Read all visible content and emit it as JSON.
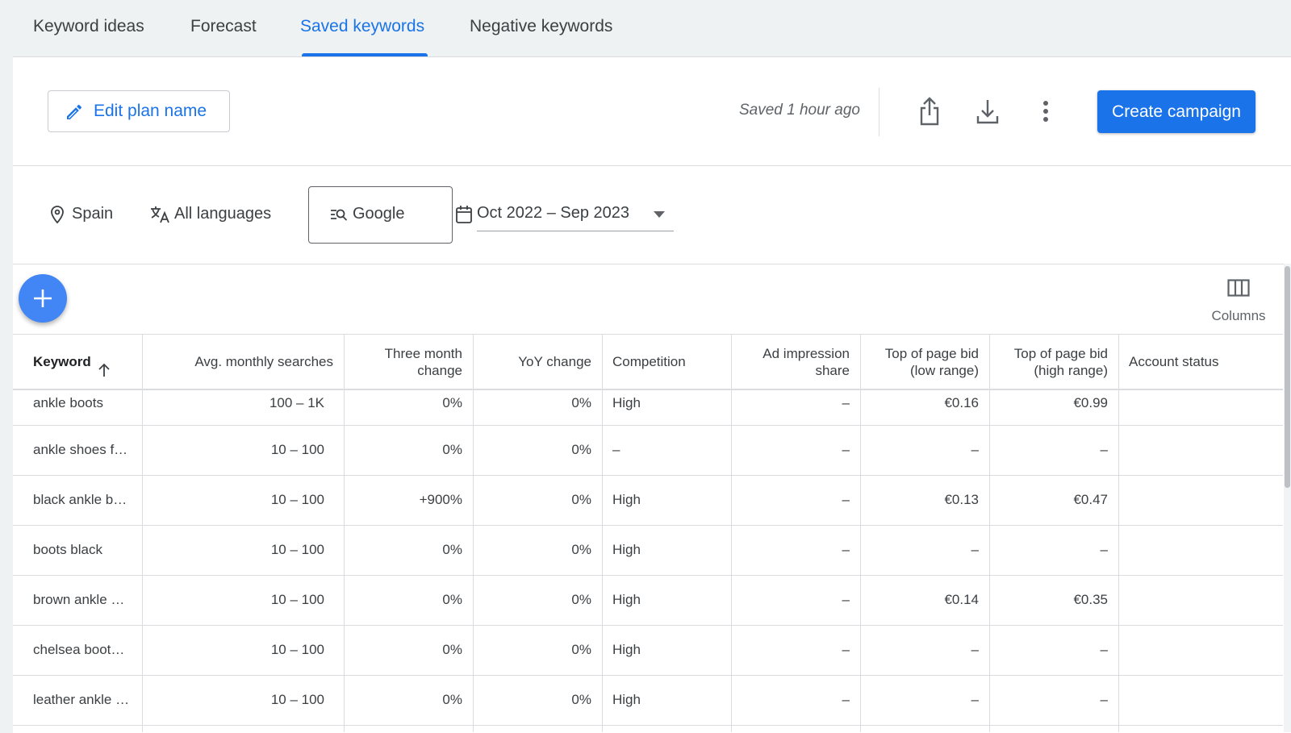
{
  "tabs": [
    {
      "label": "Keyword ideas",
      "active": false
    },
    {
      "label": "Forecast",
      "active": false
    },
    {
      "label": "Saved keywords",
      "active": true
    },
    {
      "label": "Negative keywords",
      "active": false
    }
  ],
  "header": {
    "edit_plan_label": "Edit plan name",
    "saved_status": "Saved 1 hour ago",
    "share_icon": "share-icon",
    "download_icon": "download-icon",
    "more_icon": "more-vert-icon",
    "create_campaign_label": "Create campaign"
  },
  "filters": {
    "location": "Spain",
    "language": "All languages",
    "network": "Google",
    "date_range": "Oct 2022 – Sep 2023"
  },
  "toolbar": {
    "add_icon": "plus-icon",
    "columns_label": "Columns"
  },
  "table": {
    "columns": [
      {
        "label": "Keyword",
        "align": "left",
        "sorted": "asc"
      },
      {
        "label": "Avg. monthly searches",
        "align": "right"
      },
      {
        "label": "Three month\nchange",
        "align": "right"
      },
      {
        "label": "YoY change",
        "align": "right"
      },
      {
        "label": "Competition",
        "align": "left"
      },
      {
        "label": "Ad impression\nshare",
        "align": "right"
      },
      {
        "label": "Top of page bid\n(low range)",
        "align": "right"
      },
      {
        "label": "Top of page bid\n(high range)",
        "align": "right"
      },
      {
        "label": "Account status",
        "align": "left"
      }
    ],
    "rows": [
      [
        "ankle boots",
        "100 – 1K",
        "0%",
        "0%",
        "High",
        "–",
        "€0.16",
        "€0.99",
        ""
      ],
      [
        "ankle shoes f…",
        "10 – 100",
        "0%",
        "0%",
        "–",
        "–",
        "–",
        "–",
        ""
      ],
      [
        "black ankle b…",
        "10 – 100",
        "+900%",
        "0%",
        "High",
        "–",
        "€0.13",
        "€0.47",
        ""
      ],
      [
        "boots black",
        "10 – 100",
        "0%",
        "0%",
        "High",
        "–",
        "–",
        "–",
        ""
      ],
      [
        "brown ankle …",
        "10 – 100",
        "0%",
        "0%",
        "High",
        "–",
        "€0.14",
        "€0.35",
        ""
      ],
      [
        "chelsea boot…",
        "10 – 100",
        "0%",
        "0%",
        "High",
        "–",
        "–",
        "–",
        ""
      ],
      [
        "leather ankle …",
        "10 – 100",
        "0%",
        "0%",
        "High",
        "–",
        "–",
        "–",
        ""
      ]
    ]
  },
  "colors": {
    "accent": "#1a73e8",
    "fab": "#4285f4",
    "page_bg": "#eef2f3",
    "divider": "#dadce0"
  }
}
